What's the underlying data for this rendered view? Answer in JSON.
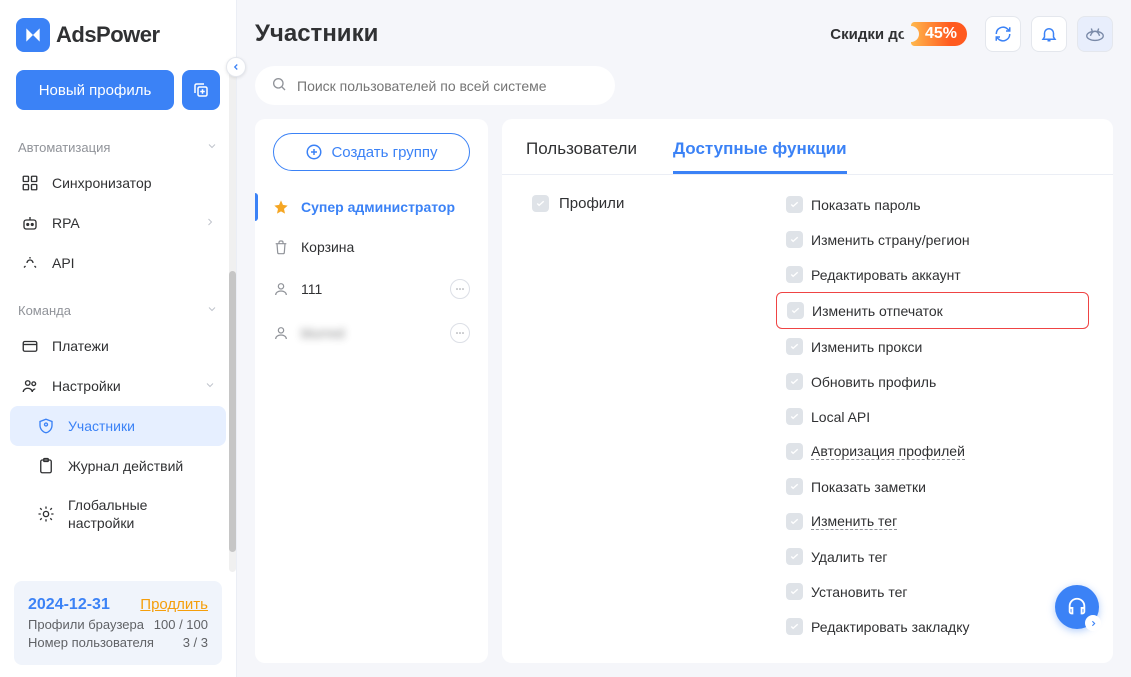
{
  "brand": {
    "name": "AdsPower"
  },
  "header": {
    "title": "Участники",
    "promo_text": "Скидки до",
    "promo_badge": "45%"
  },
  "sidebar": {
    "new_profile": "Новый профиль",
    "section_auto": "Автоматизация",
    "items_auto": [
      {
        "label": "Синхронизатор"
      },
      {
        "label": "RPA"
      },
      {
        "label": "API"
      }
    ],
    "section_team": "Команда",
    "items_team": [
      {
        "label": "Платежи"
      },
      {
        "label": "Настройки"
      }
    ],
    "items_team_sub": [
      {
        "label": "Участники"
      },
      {
        "label": "Журнал действий"
      },
      {
        "label": "Глобальные настройки"
      }
    ],
    "license": {
      "date": "2024-12-31",
      "renew": "Продлить",
      "row1_label": "Профили браузера",
      "row1_value": "100 / 100",
      "row2_label": "Номер пользователя",
      "row2_value": "3 / 3"
    }
  },
  "search": {
    "placeholder": "Поиск пользователей по всей системе"
  },
  "groups": {
    "create": "Создать группу",
    "items": [
      {
        "label": "Супер администратор"
      },
      {
        "label": "Корзина"
      },
      {
        "label": "111"
      },
      {
        "label": "blurred"
      }
    ]
  },
  "tabs": {
    "users": "Пользователи",
    "functions": "Доступные функции"
  },
  "permissions": {
    "category": "Профили",
    "items": [
      {
        "label": "Показать пароль"
      },
      {
        "label": "Изменить страну/регион"
      },
      {
        "label": "Редактировать аккаунт"
      },
      {
        "label": "Изменить отпечаток"
      },
      {
        "label": "Изменить прокси"
      },
      {
        "label": "Обновить профиль"
      },
      {
        "label": "Local API"
      },
      {
        "label": "Авторизация профилей"
      },
      {
        "label": "Показать заметки"
      },
      {
        "label": "Изменить тег"
      },
      {
        "label": "Удалить тег"
      },
      {
        "label": "Установить тег"
      },
      {
        "label": "Редактировать закладку"
      }
    ]
  }
}
